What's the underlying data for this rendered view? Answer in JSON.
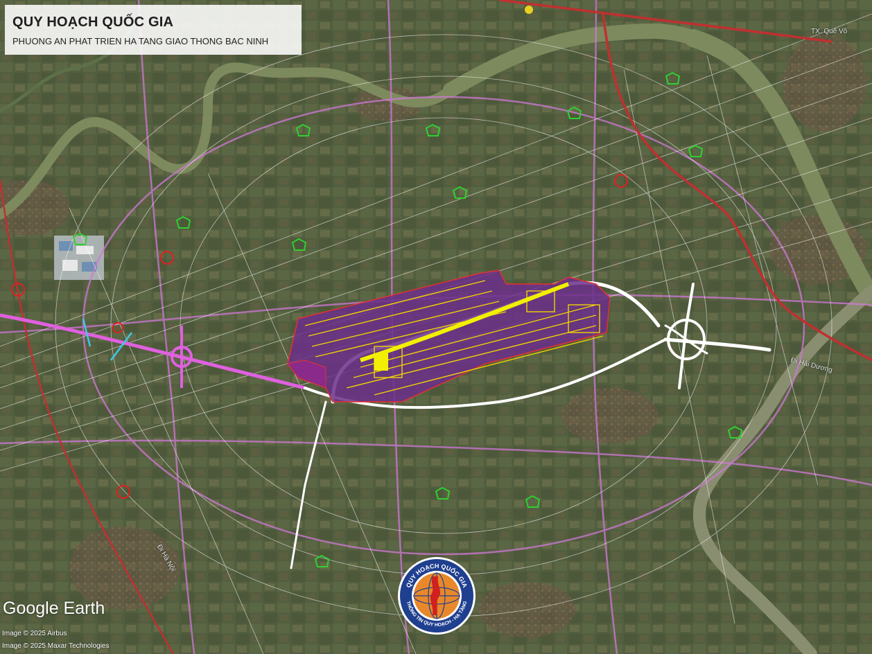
{
  "title": {
    "main": "QUY HOẠCH QUỐC GIA",
    "subtitle": "PHUONG AN PHAT TRIEN HA TANG GIAO THONG BAC NINH"
  },
  "map_attribution": {
    "logo": "Google Earth",
    "credits": [
      "Image © 2025 Airbus",
      "Image © 2025 Maxar Technologies"
    ]
  },
  "place_labels": {
    "northeast": "TX. Quế Võ",
    "east": "Đi Hải Dương",
    "southwest": "Đi Hà Nội"
  },
  "emblem": {
    "top_text": "QUY HOẠCH QUỐC GIA",
    "bottom_text": "THÔNG TIN QUY HOẠCH - HẠ TẦNG"
  },
  "colors": {
    "river": "#7d8a5e",
    "airport_fill": "#6b2f8a",
    "airport_outline": "#f2d400",
    "expressway": "#ffffff",
    "highway_red": "#c03030",
    "highway_magenta": "#e060e0",
    "ring": "#ffffff",
    "marker_green": "#30d030",
    "marker_red": "#e02020"
  }
}
